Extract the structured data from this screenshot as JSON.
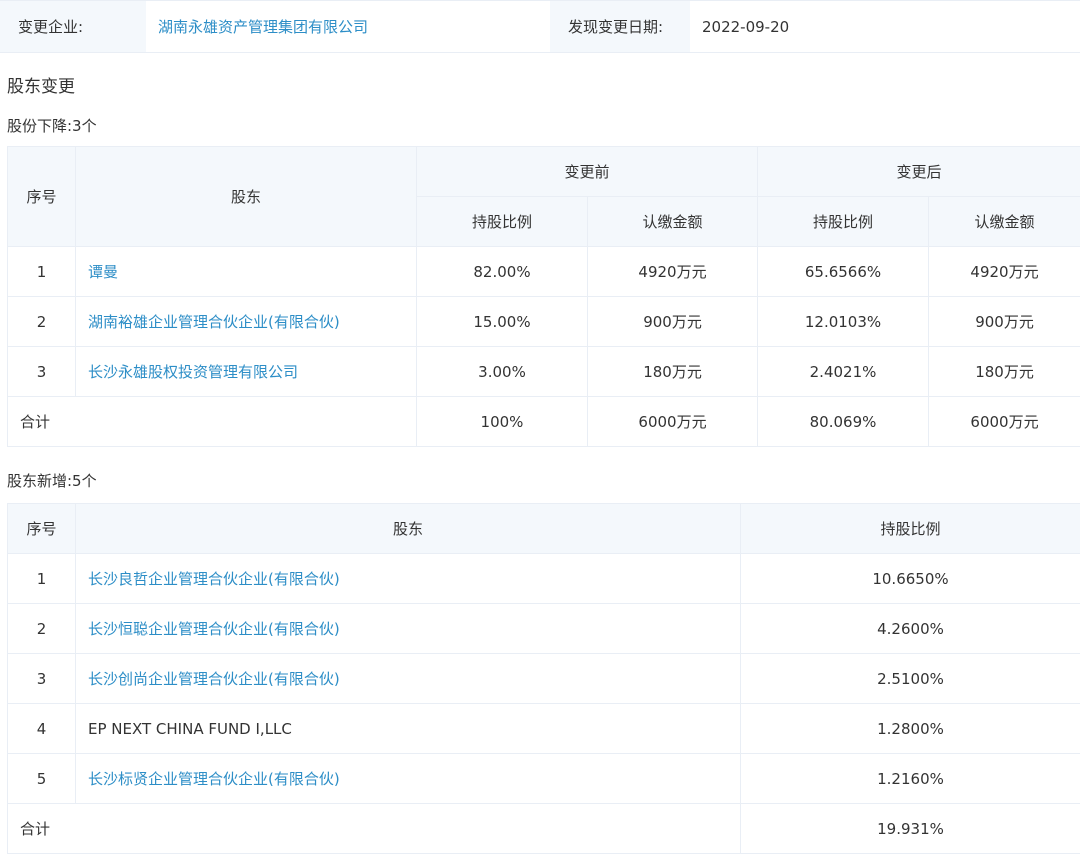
{
  "info": {
    "company_label": "变更企业:",
    "company_name": "湖南永雄资产管理集团有限公司",
    "date_label": "发现变更日期:",
    "date_value": "2022-09-20"
  },
  "section_title": "股东变更",
  "decrease": {
    "title": "股份下降:3个",
    "headers": {
      "index": "序号",
      "shareholder": "股东",
      "before": "变更前",
      "after": "变更后",
      "ratio": "持股比例",
      "amount": "认缴金额"
    },
    "rows": [
      {
        "index": "1",
        "name": "谭曼",
        "before_ratio": "82.00%",
        "before_amount": "4920万元",
        "after_ratio": "65.6566%",
        "after_amount": "4920万元"
      },
      {
        "index": "2",
        "name": "湖南裕雄企业管理合伙企业(有限合伙)",
        "before_ratio": "15.00%",
        "before_amount": "900万元",
        "after_ratio": "12.0103%",
        "after_amount": "900万元"
      },
      {
        "index": "3",
        "name": "长沙永雄股权投资管理有限公司",
        "before_ratio": "3.00%",
        "before_amount": "180万元",
        "after_ratio": "2.4021%",
        "after_amount": "180万元"
      }
    ],
    "total": {
      "label": "合计",
      "before_ratio": "100%",
      "before_amount": "6000万元",
      "after_ratio": "80.069%",
      "after_amount": "6000万元"
    }
  },
  "added": {
    "title": "股东新增:5个",
    "headers": {
      "index": "序号",
      "shareholder": "股东",
      "ratio": "持股比例"
    },
    "rows": [
      {
        "index": "1",
        "name": "长沙良哲企业管理合伙企业(有限合伙)",
        "ratio": "10.6650%"
      },
      {
        "index": "2",
        "name": "长沙恒聪企业管理合伙企业(有限合伙)",
        "ratio": "4.2600%"
      },
      {
        "index": "3",
        "name": "长沙创尚企业管理合伙企业(有限合伙)",
        "ratio": "2.5100%"
      },
      {
        "index": "4",
        "name": "EP NEXT CHINA FUND I,LLC",
        "ratio": "1.2800%"
      },
      {
        "index": "5",
        "name": "长沙标贤企业管理合伙企业(有限合伙)",
        "ratio": "1.2160%"
      }
    ],
    "total": {
      "label": "合计",
      "ratio": "19.931%"
    }
  },
  "colors": {
    "link": "#2d8ec7",
    "header_bg": "#f4f8fc",
    "border": "#e9eef5"
  }
}
